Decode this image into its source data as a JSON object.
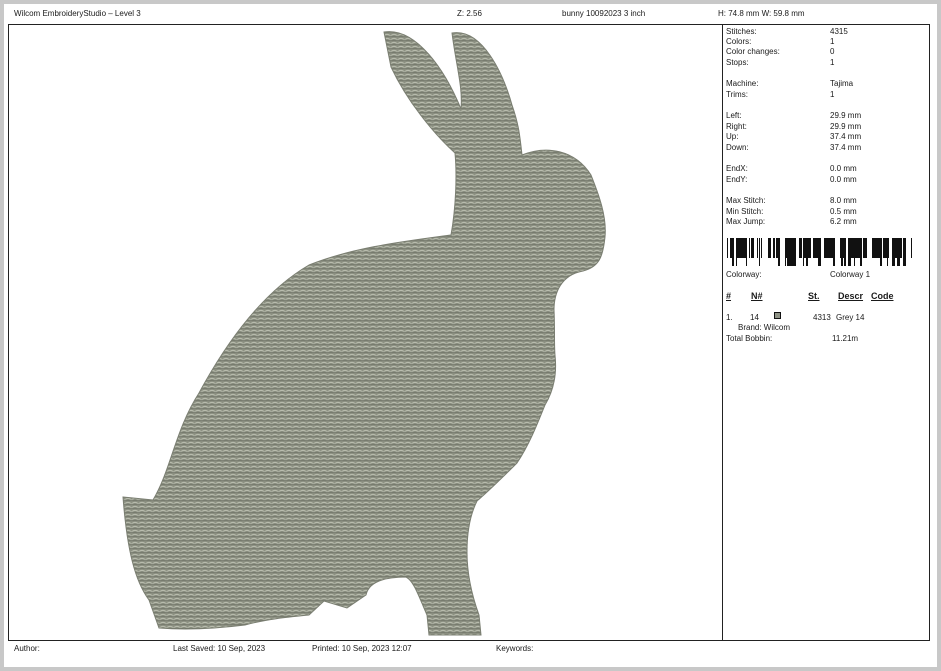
{
  "header": {
    "app_title": "Wilcom EmbroideryStudio – Level 3",
    "zoom": "Z: 2.56",
    "design_name": "bunny 10092023 3 inch",
    "dimensions": "H: 74.8 mm   W: 59.8 mm"
  },
  "info": {
    "stitches_label": "Stitches:",
    "stitches_value": "4315",
    "colors_label": "Colors:",
    "colors_value": "1",
    "color_changes_label": "Color changes:",
    "color_changes_value": "0",
    "stops_label": "Stops:",
    "stops_value": "1",
    "machine_label": "Machine:",
    "machine_value": "Tajima",
    "trims_label": "Trims:",
    "trims_value": "1",
    "left_label": "Left:",
    "left_value": "29.9 mm",
    "right_label": "Right:",
    "right_value": "29.9 mm",
    "up_label": "Up:",
    "up_value": "37.4 mm",
    "down_label": "Down:",
    "down_value": "37.4 mm",
    "endx_label": "EndX:",
    "endx_value": "0.0 mm",
    "endy_label": "EndY:",
    "endy_value": "0.0 mm",
    "max_stitch_label": "Max Stitch:",
    "max_stitch_value": "8.0 mm",
    "min_stitch_label": "Min Stitch:",
    "min_stitch_value": "0.5 mm",
    "max_jump_label": "Max Jump:",
    "max_jump_value": "6.2 mm",
    "colorway_label": "Colorway:",
    "colorway_value": "Colorway 1"
  },
  "color_table": {
    "headers": {
      "index": "#",
      "number": "N#",
      "stitches": "St.",
      "descr": "Descr",
      "code": "Code"
    },
    "rows": [
      {
        "index": "1.",
        "number": "14",
        "swatch_color": "#8f9386",
        "stitches": "4313",
        "descr": "Grey 14",
        "brand": "Brand: Wilcom"
      }
    ],
    "total_bobbin_label": "Total Bobbin:",
    "total_bobbin_value": "11.21m"
  },
  "footer": {
    "author": "Author:",
    "last_saved": "Last Saved: 10 Sep, 2023",
    "printed": "Printed: 10 Sep, 2023 12:07",
    "keywords": "Keywords:"
  },
  "design": {
    "thread_color": "#8a8e80",
    "highlight_color": "#c3c7b8"
  }
}
